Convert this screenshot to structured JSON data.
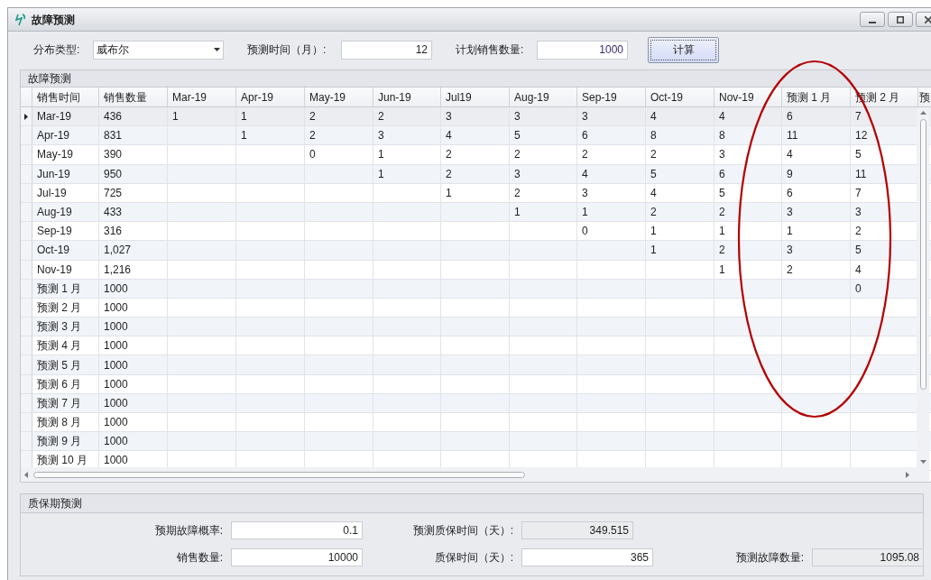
{
  "window": {
    "title": "故障预测"
  },
  "toolbar": {
    "distribution_label": "分布类型:",
    "distribution_value": "威布尔",
    "months_label": "预测时间（月）:",
    "months_value": "12",
    "plan_label": "计划销售数量:",
    "plan_value": "1000",
    "calculate_button": "计算"
  },
  "grid": {
    "title": "故障预测",
    "columns": [
      "销售时间",
      "销售数量",
      "Mar-19",
      "Apr-19",
      "May-19",
      "Jun-19",
      "Jul19",
      "Aug-19",
      "Sep-19",
      "Oct-19",
      "Nov-19",
      "预测 1 月",
      "预测 2 月",
      "预"
    ],
    "rows": [
      {
        "selected": true,
        "cells": [
          "Mar-19",
          "436",
          "1",
          "1",
          "2",
          "2",
          "3",
          "3",
          "3",
          "4",
          "4",
          "6",
          "7"
        ]
      },
      {
        "selected": false,
        "cells": [
          "Apr-19",
          "831",
          null,
          "1",
          "2",
          "3",
          "4",
          "5",
          "6",
          "8",
          "8",
          "11",
          "12"
        ]
      },
      {
        "selected": false,
        "cells": [
          "May-19",
          "390",
          null,
          null,
          "0",
          "1",
          "2",
          "2",
          "2",
          "2",
          "3",
          "4",
          "5"
        ]
      },
      {
        "selected": false,
        "cells": [
          "Jun-19",
          "950",
          null,
          null,
          null,
          "1",
          "2",
          "3",
          "4",
          "5",
          "6",
          "9",
          "11"
        ]
      },
      {
        "selected": false,
        "cells": [
          "Jul-19",
          "725",
          null,
          null,
          null,
          null,
          "1",
          "2",
          "3",
          "4",
          "5",
          "6",
          "7"
        ]
      },
      {
        "selected": false,
        "cells": [
          "Aug-19",
          "433",
          null,
          null,
          null,
          null,
          null,
          "1",
          "1",
          "2",
          "2",
          "3",
          "3"
        ]
      },
      {
        "selected": false,
        "cells": [
          "Sep-19",
          "316",
          null,
          null,
          null,
          null,
          null,
          null,
          "0",
          "1",
          "1",
          "1",
          "2"
        ]
      },
      {
        "selected": false,
        "cells": [
          "Oct-19",
          "1,027",
          null,
          null,
          null,
          null,
          null,
          null,
          null,
          "1",
          "2",
          "3",
          "5"
        ]
      },
      {
        "selected": false,
        "cells": [
          "Nov-19",
          "1,216",
          null,
          null,
          null,
          null,
          null,
          null,
          null,
          null,
          "1",
          "2",
          "4"
        ]
      },
      {
        "selected": false,
        "cells": [
          "预测 1 月",
          "1000",
          null,
          null,
          null,
          null,
          null,
          null,
          null,
          null,
          null,
          null,
          "0"
        ]
      },
      {
        "selected": false,
        "cells": [
          "预测 2 月",
          "1000"
        ]
      },
      {
        "selected": false,
        "cells": [
          "预测 3 月",
          "1000"
        ]
      },
      {
        "selected": false,
        "cells": [
          "预测 4 月",
          "1000"
        ]
      },
      {
        "selected": false,
        "cells": [
          "预测 5 月",
          "1000"
        ]
      },
      {
        "selected": false,
        "cells": [
          "预测 6 月",
          "1000"
        ]
      },
      {
        "selected": false,
        "cells": [
          "预测 7 月",
          "1000"
        ]
      },
      {
        "selected": false,
        "cells": [
          "预测 8 月",
          "1000"
        ]
      },
      {
        "selected": false,
        "cells": [
          "预测 9 月",
          "1000"
        ]
      },
      {
        "selected": false,
        "cells": [
          "预测 10 月",
          "1000"
        ]
      }
    ]
  },
  "warranty": {
    "title": "质保期预测",
    "fields": [
      {
        "label": "预期故障概率:",
        "value": "0.1",
        "readonly": false
      },
      {
        "label": "预测质保时间（天）:",
        "value": "349.515",
        "readonly": true
      },
      {
        "label": "销售数量:",
        "value": "10000",
        "readonly": false
      },
      {
        "label": "质保时间（天）:",
        "value": "365",
        "readonly": false
      },
      {
        "label": "预测故障数量:",
        "value": "1095.08",
        "readonly": true
      }
    ]
  }
}
